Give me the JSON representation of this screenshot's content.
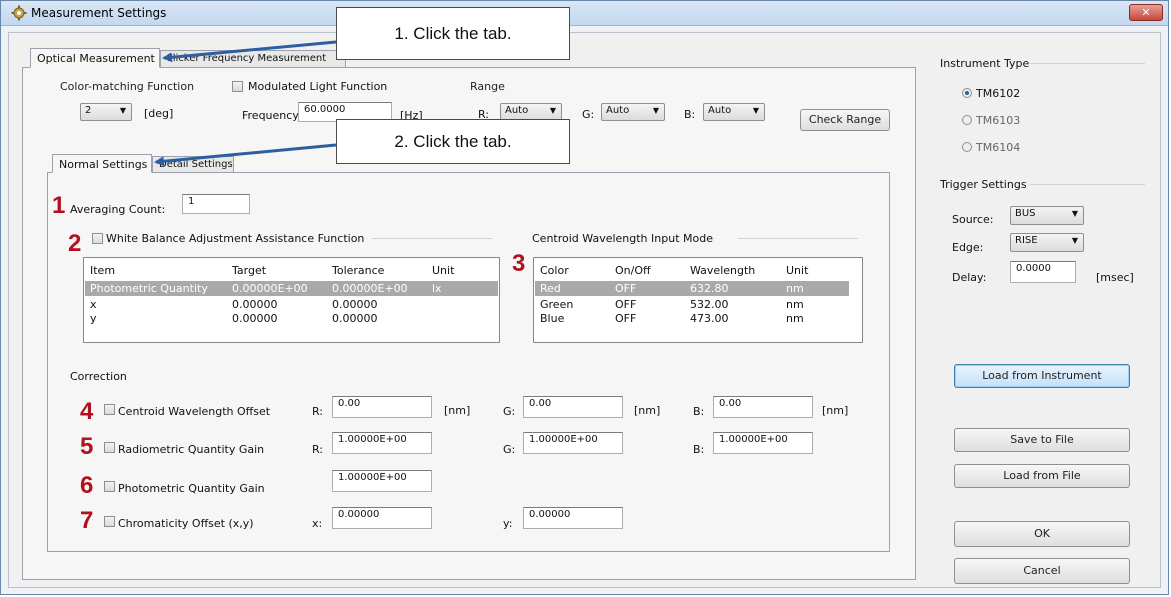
{
  "window": {
    "title": "Measurement Settings",
    "close_label": "✕"
  },
  "main_tabs": [
    {
      "label": "Optical Measurement"
    },
    {
      "label": "Flicker Frequency Measurement"
    }
  ],
  "color_matching": {
    "label": "Color-matching Function",
    "value": "2",
    "unit": "[deg]"
  },
  "modulated": {
    "label": "Modulated Light Function",
    "freq_label": "Frequency:",
    "freq_value": "60.0000",
    "freq_unit": "[Hz]"
  },
  "range": {
    "label": "Range",
    "r_label": "R:",
    "r_value": "Auto",
    "g_label": "G:",
    "g_value": "Auto",
    "b_label": "B:",
    "b_value": "Auto"
  },
  "check_range_label": "Check Range",
  "inner_tabs": [
    {
      "label": "Normal Settings"
    },
    {
      "label": "Detail Settings"
    }
  ],
  "averaging": {
    "label": "Averaging Count:",
    "value": "1"
  },
  "white_balance": {
    "label": "White Balance Adjustment Assistance Function",
    "headers": [
      "Item",
      "Target",
      "Tolerance",
      "Unit"
    ],
    "rows": [
      [
        "Photometric Quantity",
        "0.00000E+00",
        "0.00000E+00",
        "lx"
      ],
      [
        "x",
        "0.00000",
        "0.00000",
        ""
      ],
      [
        "y",
        "0.00000",
        "0.00000",
        ""
      ]
    ]
  },
  "centroid_mode": {
    "label": "Centroid Wavelength Input Mode",
    "headers": [
      "Color",
      "On/Off",
      "Wavelength",
      "Unit"
    ],
    "rows": [
      [
        "Red",
        "OFF",
        "632.80",
        "nm"
      ],
      [
        "Green",
        "OFF",
        "532.00",
        "nm"
      ],
      [
        "Blue",
        "OFF",
        "473.00",
        "nm"
      ]
    ]
  },
  "correction": {
    "label": "Correction",
    "centroid_offset": {
      "label": "Centroid Wavelength Offset",
      "r_label": "R:",
      "r": "0.00",
      "g_label": "G:",
      "g": "0.00",
      "b_label": "B:",
      "b": "0.00",
      "unit": "[nm]"
    },
    "radiometric_gain": {
      "label": "Radiometric Quantity Gain",
      "r_label": "R:",
      "r": "1.00000E+00",
      "g_label": "G:",
      "g": "1.00000E+00",
      "b_label": "B:",
      "b": "1.00000E+00"
    },
    "photometric_gain": {
      "label": "Photometric Quantity Gain",
      "value": "1.00000E+00"
    },
    "chromaticity_offset": {
      "label": "Chromaticity Offset (x,y)",
      "x_label": "x:",
      "x": "0.00000",
      "y_label": "y:",
      "y": "0.00000"
    }
  },
  "instrument": {
    "label": "Instrument Type",
    "options": [
      "TM6102",
      "TM6103",
      "TM6104"
    ],
    "selected": "TM6102"
  },
  "trigger": {
    "label": "Trigger Settings",
    "source_label": "Source:",
    "source": "BUS",
    "edge_label": "Edge:",
    "edge": "RISE",
    "delay_label": "Delay:",
    "delay": "0.0000",
    "delay_unit": "[msec]"
  },
  "buttons": {
    "load_instrument": "Load from Instrument",
    "save_file": "Save to File",
    "load_file": "Load from File",
    "ok": "OK",
    "cancel": "Cancel"
  },
  "callouts": {
    "one": "1. Click the tab.",
    "two": "2. Click the tab."
  },
  "markers": [
    "1",
    "2",
    "3",
    "4",
    "5",
    "6",
    "7"
  ],
  "colors": {
    "marker": "#b01020",
    "arrow": "#2c5ea0",
    "selected_row": "#a9a9a9"
  }
}
